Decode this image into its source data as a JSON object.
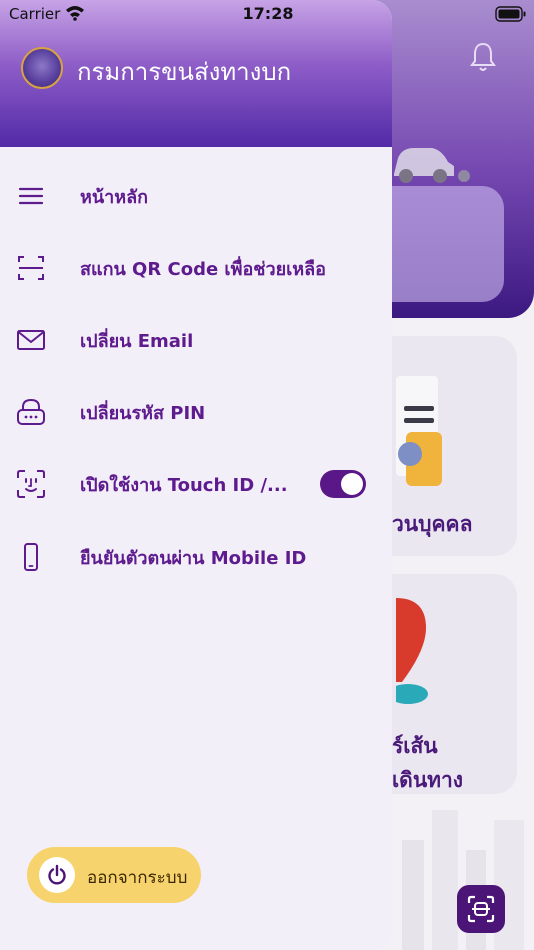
{
  "status_bar": {
    "carrier": "Carrier",
    "time": "17:28"
  },
  "drawer": {
    "title": "กรมการขนส่งทางบก",
    "menu": [
      {
        "label": "หน้าหลัก",
        "icon": "menu-icon"
      },
      {
        "label": "สแกน QR Code เพื่อช่วยเหลือ",
        "icon": "qr-scan-icon"
      },
      {
        "label": "เปลี่ยน Email",
        "icon": "envelope-icon"
      },
      {
        "label": "เปลี่ยนรหัส PIN",
        "icon": "pin-lock-icon"
      },
      {
        "label": "เปิดใช้งาน Touch ID /...",
        "icon": "face-id-icon",
        "toggle_on": true
      },
      {
        "label": "ยืนยันตัวตนผ่าน Mobile ID",
        "icon": "mobile-phone-icon"
      }
    ],
    "logout_label": "ออกจากระบบ"
  },
  "background": {
    "tile_1_label": "วนบุคคล",
    "tile_2_line_1": "ร์เส้น",
    "tile_2_line_2": "เดินทาง"
  },
  "colors": {
    "accent": "#5e1b8e",
    "toggle_on": "#5a1787",
    "logout_bg": "#f6d36d",
    "drawer_bg": "#f3eff9"
  }
}
